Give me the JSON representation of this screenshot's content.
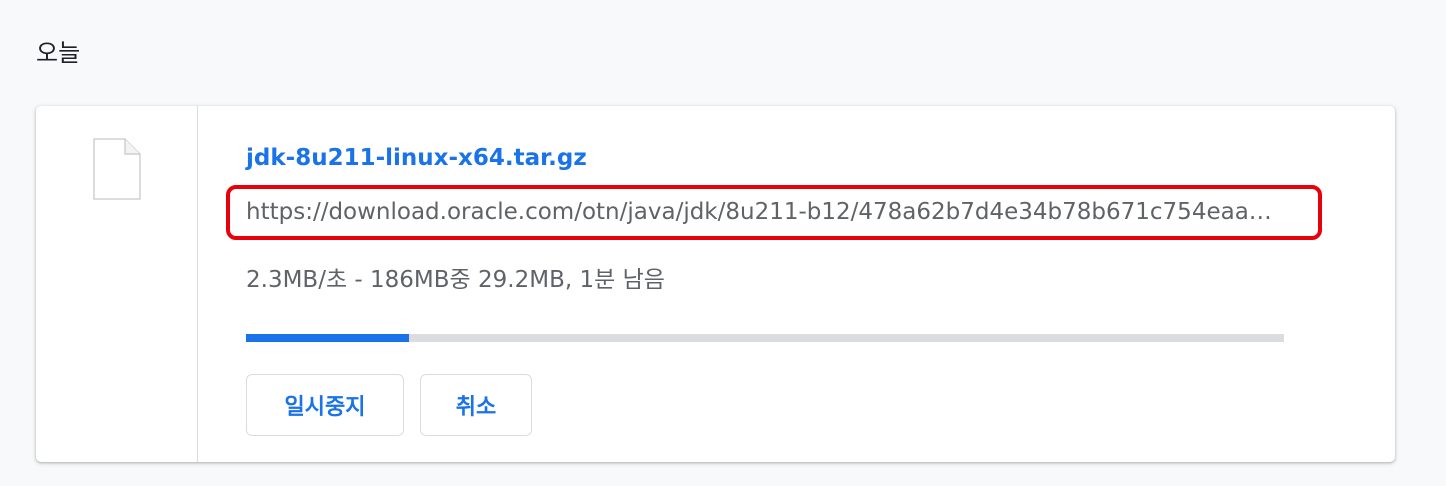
{
  "section": {
    "heading": "오늘"
  },
  "download": {
    "icon": "file-icon",
    "file_name": "jdk-8u211-linux-x64.tar.gz",
    "source_url": "https://download.oracle.com/otn/java/jdk/8u211-b12/478a62b7d4e34b78b671c754eaa…",
    "status": "2.3MB/초 - 186MB중 29.2MB, 1분 남음",
    "progress_fraction": 0.157,
    "buttons": {
      "pause_label": "일시중지",
      "cancel_label": "취소"
    }
  },
  "colors": {
    "accent": "#1a73e8",
    "highlight": "#e8000b",
    "track": "#dadce0",
    "text_secondary": "#5f6368"
  }
}
